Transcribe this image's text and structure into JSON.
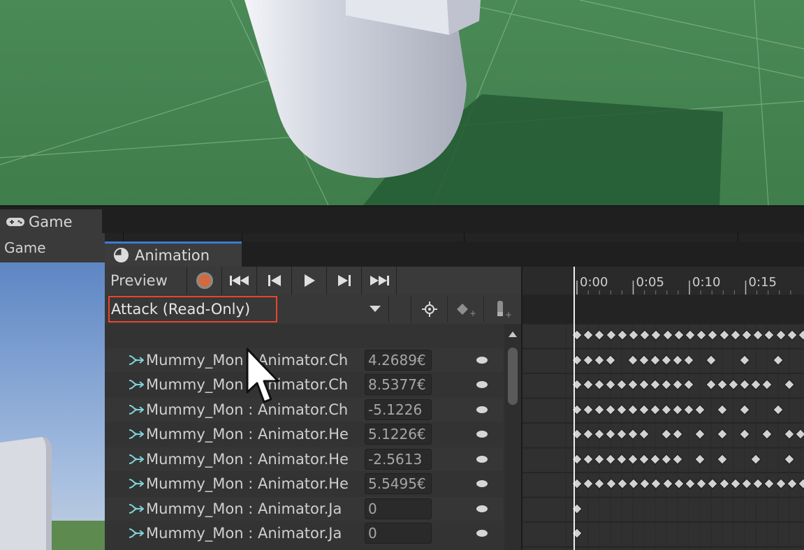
{
  "game_panel": {
    "tab_label": "Game",
    "toolbar_label": "Game"
  },
  "animation_window": {
    "tab_label": "Animation",
    "preview_label": "Preview",
    "frame_value": "0",
    "clip_selector": "Attack (Read-Only)",
    "timeline_ticks": [
      "0:00",
      "0:05",
      "0:10",
      "0:15"
    ],
    "properties": [
      {
        "name": "Mummy_Mon : Animator.Ch",
        "value": "4.2689€"
      },
      {
        "name": "Mummy_Mon : Animator.Ch",
        "value": "8.5377€"
      },
      {
        "name": "Mummy_Mon : Animator.Ch",
        "value": "-5.1226"
      },
      {
        "name": "Mummy_Mon : Animator.He",
        "value": "5.1226€"
      },
      {
        "name": "Mummy_Mon : Animator.He",
        "value": "-2.5613"
      },
      {
        "name": "Mummy_Mon : Animator.He",
        "value": "5.5495€"
      },
      {
        "name": "Mummy_Mon : Animator.Ja",
        "value": "0"
      },
      {
        "name": "Mummy_Mon : Animator.Ja",
        "value": "0"
      }
    ]
  },
  "colors": {
    "selection_highlight": "#e8452e",
    "active_tab_accent": "#3d7bd6",
    "record_button": "#d16a3f",
    "keyframe": "#d2d2d2"
  },
  "icons": {
    "game_tab": "gamepad-icon",
    "animation_tab": "clock-icon",
    "record": "record-icon",
    "first_key": "first-key-icon",
    "prev_key": "prev-key-icon",
    "play": "play-icon",
    "next_key": "next-key-icon",
    "last_key": "last-key-icon",
    "add_keyframe": "add-keyframe-icon",
    "add_event": "add-event-icon",
    "filter": "crosshair-icon",
    "property": "curve-icon"
  }
}
